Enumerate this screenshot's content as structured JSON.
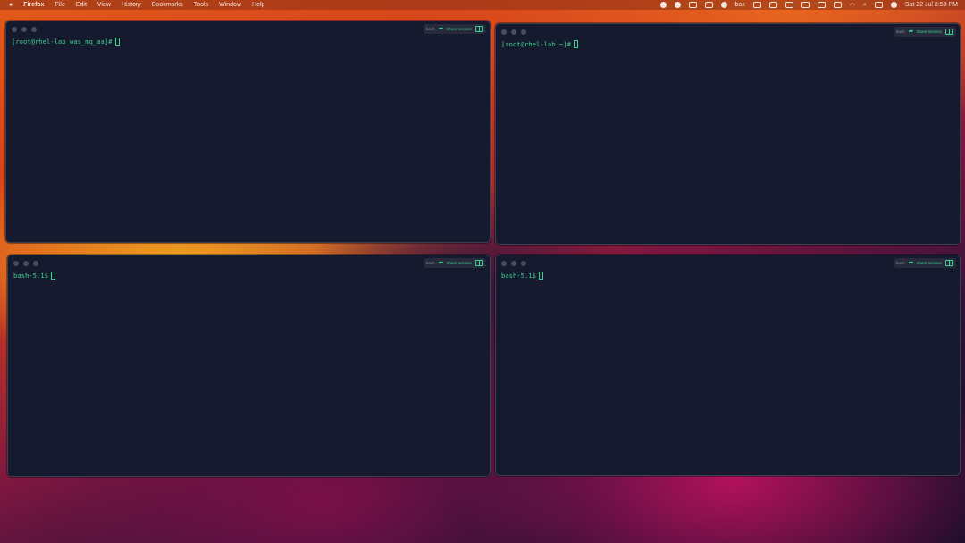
{
  "menubar": {
    "app_name": "Firefox",
    "menus": [
      "File",
      "Edit",
      "View",
      "History",
      "Bookmarks",
      "Tools",
      "Window",
      "Help"
    ],
    "datetime": "Sat 22 Jul  8:53 PM",
    "status_text": "box"
  },
  "terminals": [
    {
      "prompt": "[root@rhel-lab was_mq_aa]#",
      "toolbar_label": "bash",
      "share_label": "Share session"
    },
    {
      "prompt": "[root@rhel-lab ~]#",
      "toolbar_label": "bash",
      "share_label": "Share session"
    },
    {
      "prompt": "bash-5.1$",
      "toolbar_label": "bash",
      "share_label": "Share session"
    },
    {
      "prompt": "bash-5.1$",
      "toolbar_label": "bash",
      "share_label": "Share session"
    }
  ],
  "colors": {
    "prompt": "#3fcf8e",
    "terminal_bg": "#151a2e"
  },
  "icons": [
    "apple-icon",
    "share-icon",
    "split-panel-icon",
    "wifi-icon",
    "search-icon",
    "battery-icon"
  ]
}
